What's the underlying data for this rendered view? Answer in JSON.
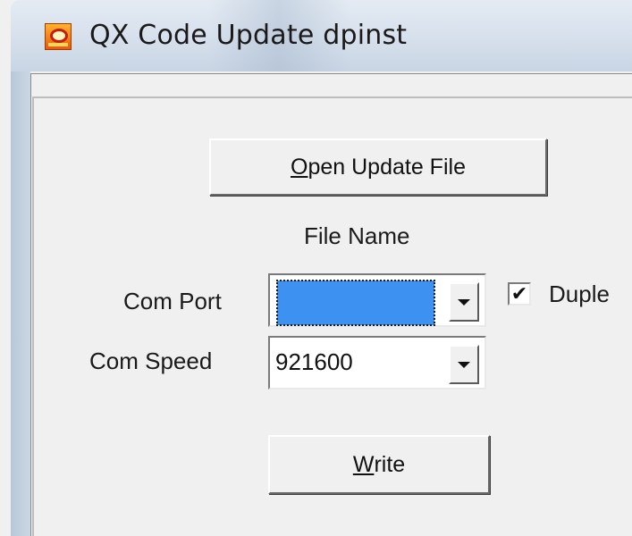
{
  "window": {
    "title": "QX Code Update dpinst",
    "icon": "app-icon"
  },
  "buttons": {
    "open_update_file": {
      "mnemonic": "O",
      "rest": "pen Update File"
    },
    "write": {
      "mnemonic": "W",
      "rest": "rite"
    }
  },
  "file_name_label": "File Name",
  "com_port": {
    "label": "Com Port",
    "value": "",
    "selected_highlight": "#3d91f0"
  },
  "com_speed": {
    "label": "Com Speed",
    "value": "921600"
  },
  "duplex": {
    "label": "Duple",
    "checked": true,
    "check_glyph": "✔"
  }
}
